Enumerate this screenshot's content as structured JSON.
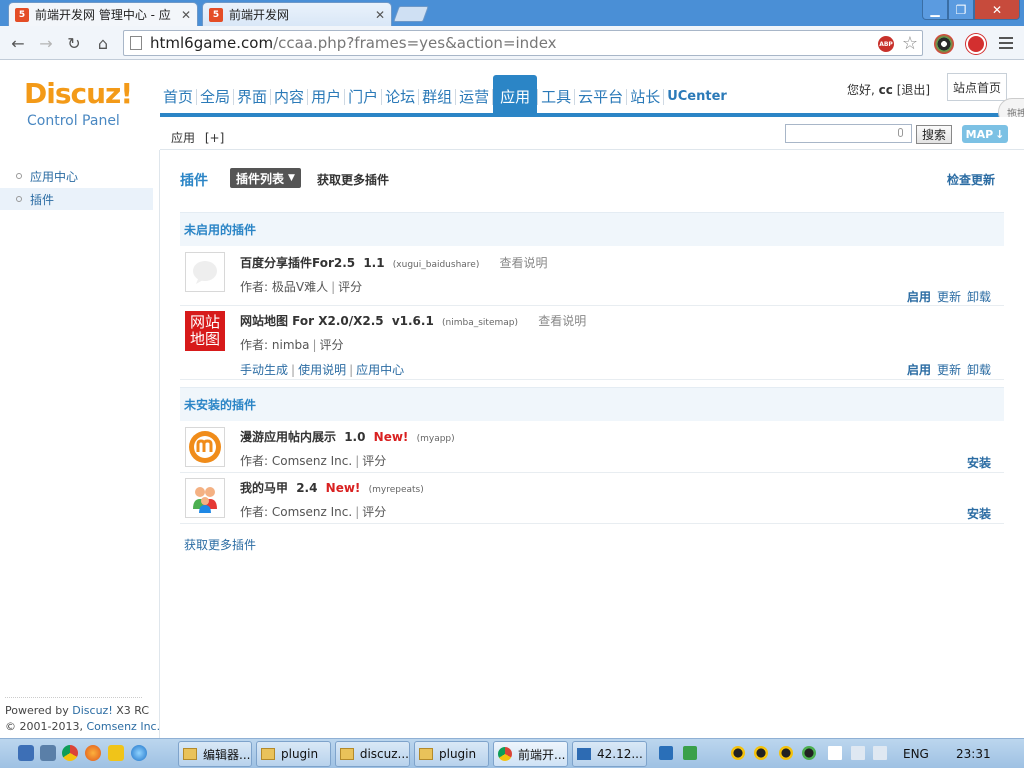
{
  "browser": {
    "tabs": [
      {
        "favicon": "5",
        "title": "前端开发网 管理中心 - 应",
        "active": true
      },
      {
        "favicon": "5",
        "title": "前端开发网",
        "active": false
      }
    ],
    "url_host": "html6game.com",
    "url_path": "/ccaa.php?frames=yes&action=index",
    "abp_label": "ABP",
    "icons": [
      "back-arrow-icon",
      "forward-arrow-icon",
      "reload-icon",
      "home-icon",
      "star-icon",
      "menu-icon"
    ]
  },
  "header": {
    "logo": "Discuz!",
    "logo_sub": "Control Panel",
    "nav": [
      "首页",
      "全局",
      "界面",
      "内容",
      "用户",
      "门户",
      "论坛",
      "群组",
      "运营",
      "应用",
      "工具",
      "云平台",
      "站长",
      "UCenter"
    ],
    "active_nav": "应用",
    "greeting": "您好,",
    "username": "cc",
    "logout": "[退出]",
    "site_home": "站点首页",
    "drag_label": "拖拽"
  },
  "subbar": {
    "crumb": "应用",
    "add": "[+]",
    "search_button": "搜索",
    "map_label": "MAP"
  },
  "sidebar": {
    "items": [
      {
        "label": "应用中心",
        "active": false
      },
      {
        "label": "插件",
        "active": true
      }
    ],
    "powered_prefix": "Powered by",
    "powered_link": "Discuz!",
    "powered_version": "X3 RC",
    "copyright_prefix": "© 2001-2013,",
    "copyright_link": "Comsenz Inc."
  },
  "main": {
    "title": "插件",
    "list_tab": "插件列表",
    "get_more_top": "获取更多插件",
    "check_update": "检查更新",
    "section_disabled": "未启用的插件",
    "section_uninstalled": "未安装的插件",
    "get_more_bottom": "获取更多插件"
  },
  "plugins_disabled": [
    {
      "name": "百度分享插件For2.5",
      "version": "1.1",
      "id": "(xugui_baidushare)",
      "doc": "查看说明",
      "author_prefix": "作者:",
      "author": "极品V难人",
      "rate": "评分",
      "actions": [
        "启用",
        "更新",
        "卸载"
      ]
    },
    {
      "name": "网站地图 For X2.0/X2.5",
      "version": "v1.6.1",
      "id": "(nimba_sitemap)",
      "doc": "查看说明",
      "author_prefix": "作者:",
      "author": "nimba",
      "rate": "评分",
      "links": [
        "手动生成",
        "使用说明",
        "应用中心"
      ],
      "icon_text": "网站地图",
      "actions": [
        "启用",
        "更新",
        "卸载"
      ]
    }
  ],
  "plugins_uninstalled": [
    {
      "name": "漫游应用帖内展示",
      "version": "1.0",
      "new": "New!",
      "id": "(myapp)",
      "author_prefix": "作者:",
      "author": "Comsenz Inc.",
      "rate": "评分",
      "action": "安装"
    },
    {
      "name": "我的马甲",
      "version": "2.4",
      "new": "New!",
      "id": "(myrepeats)",
      "author_prefix": "作者:",
      "author": "Comsenz Inc.",
      "rate": "评分",
      "action": "安装"
    }
  ],
  "taskbar": {
    "buttons": [
      {
        "label": "编辑器...",
        "icon": "folder-icon"
      },
      {
        "label": "plugin",
        "icon": "folder-icon"
      },
      {
        "label": "discuz...",
        "icon": "folder-icon"
      },
      {
        "label": "plugin",
        "icon": "folder-icon"
      },
      {
        "label": "前端开...",
        "icon": "chrome-icon"
      },
      {
        "label": "42.12...",
        "icon": "terminal-icon"
      }
    ],
    "lang": "ENG",
    "time": "23:31"
  }
}
